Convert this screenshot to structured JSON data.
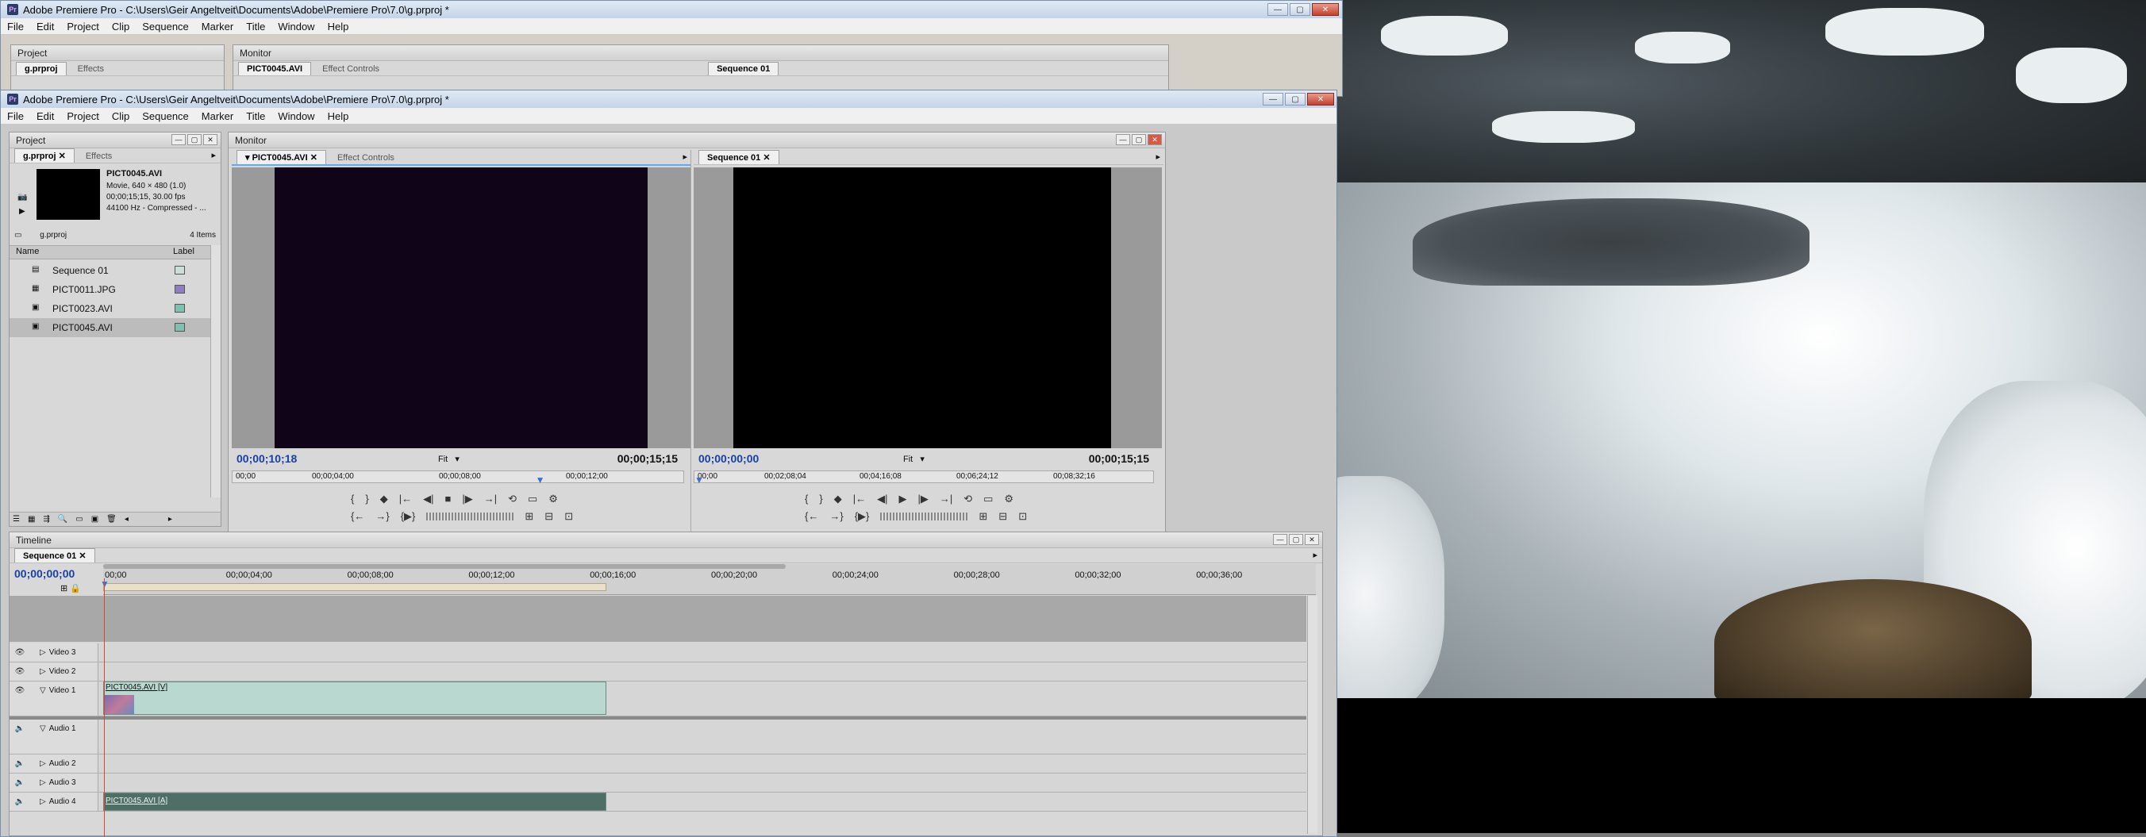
{
  "back_window": {
    "title": "Adobe Premiere Pro - C:\\Users\\Geir Angeltveit\\Documents\\Adobe\\Premiere Pro\\7.0\\g.prproj *",
    "menu": [
      "File",
      "Edit",
      "Project",
      "Clip",
      "Sequence",
      "Marker",
      "Title",
      "Window",
      "Help"
    ],
    "project_title": "Project",
    "project_tabs": [
      "g.prproj",
      "Effects"
    ],
    "monitor_title": "Monitor",
    "monitor_tabs": [
      "PICT0045.AVI",
      "Effect Controls"
    ],
    "sequence_tab": "Sequence 01"
  },
  "window": {
    "title": "Adobe Premiere Pro - C:\\Users\\Geir Angeltveit\\Documents\\Adobe\\Premiere Pro\\7.0\\g.prproj *",
    "menu": [
      "File",
      "Edit",
      "Project",
      "Clip",
      "Sequence",
      "Marker",
      "Title",
      "Window",
      "Help"
    ]
  },
  "project": {
    "title": "Project",
    "tabs": [
      "g.prproj",
      "Effects"
    ],
    "preview_name": "PICT0045.AVI",
    "preview_line1": "Movie, 640 × 480 (1.0)",
    "preview_line2": "00;00;15;15, 30.00 fps",
    "preview_line3": "44100 Hz - Compressed - ...",
    "bin_name": "g.prproj",
    "item_count": "4 Items",
    "col_name": "Name",
    "col_label": "Label",
    "items": [
      {
        "name": "Sequence 01",
        "color": "#c8e0d8"
      },
      {
        "name": "PICT0011.JPG",
        "color": "#8f7fc0"
      },
      {
        "name": "PICT0023.AVI",
        "color": "#7fc0b0"
      },
      {
        "name": "PICT0045.AVI",
        "color": "#7fc0b0"
      }
    ]
  },
  "monitor": {
    "title": "Monitor",
    "source_tabs": [
      "PICT0045.AVI",
      "Effect Controls"
    ],
    "program_tab": "Sequence 01",
    "source_tc": "00;00;10;18",
    "source_fit": "Fit",
    "source_duration": "00;00;15;15",
    "source_ruler": [
      "00;00",
      "00;00;04;00",
      "00;00;08;00",
      "00;00;12;00"
    ],
    "source_playhead_fraction": 0.68,
    "program_tc": "00;00;00;00",
    "program_fit": "Fit",
    "program_duration": "00;00;15;15",
    "program_ruler": [
      "00;00",
      "00;02;08;04",
      "00;04;16;08",
      "00;06;24;12",
      "00;08;32;16"
    ],
    "program_playhead_fraction": 0.0
  },
  "timeline": {
    "title": "Timeline",
    "tab": "Sequence 01",
    "timecode": "00;00;00;00",
    "ruler": [
      "00;00",
      "00;00;04;00",
      "00;00;08;00",
      "00;00;12;00",
      "00;00;16;00",
      "00;00;20;00",
      "00;00;24;00",
      "00;00;28;00",
      "00;00;32;00",
      "00;00;36;00"
    ],
    "video_tracks": [
      "Video 3",
      "Video 2",
      "Video 1"
    ],
    "audio_tracks": [
      "Audio 1",
      "Audio 2",
      "Audio 3",
      "Audio 4"
    ],
    "video_clip": "PICT0045.AVI [V]",
    "audio_clip": "PICT0045.AVI [A]",
    "clip_end_fraction": 0.415
  }
}
